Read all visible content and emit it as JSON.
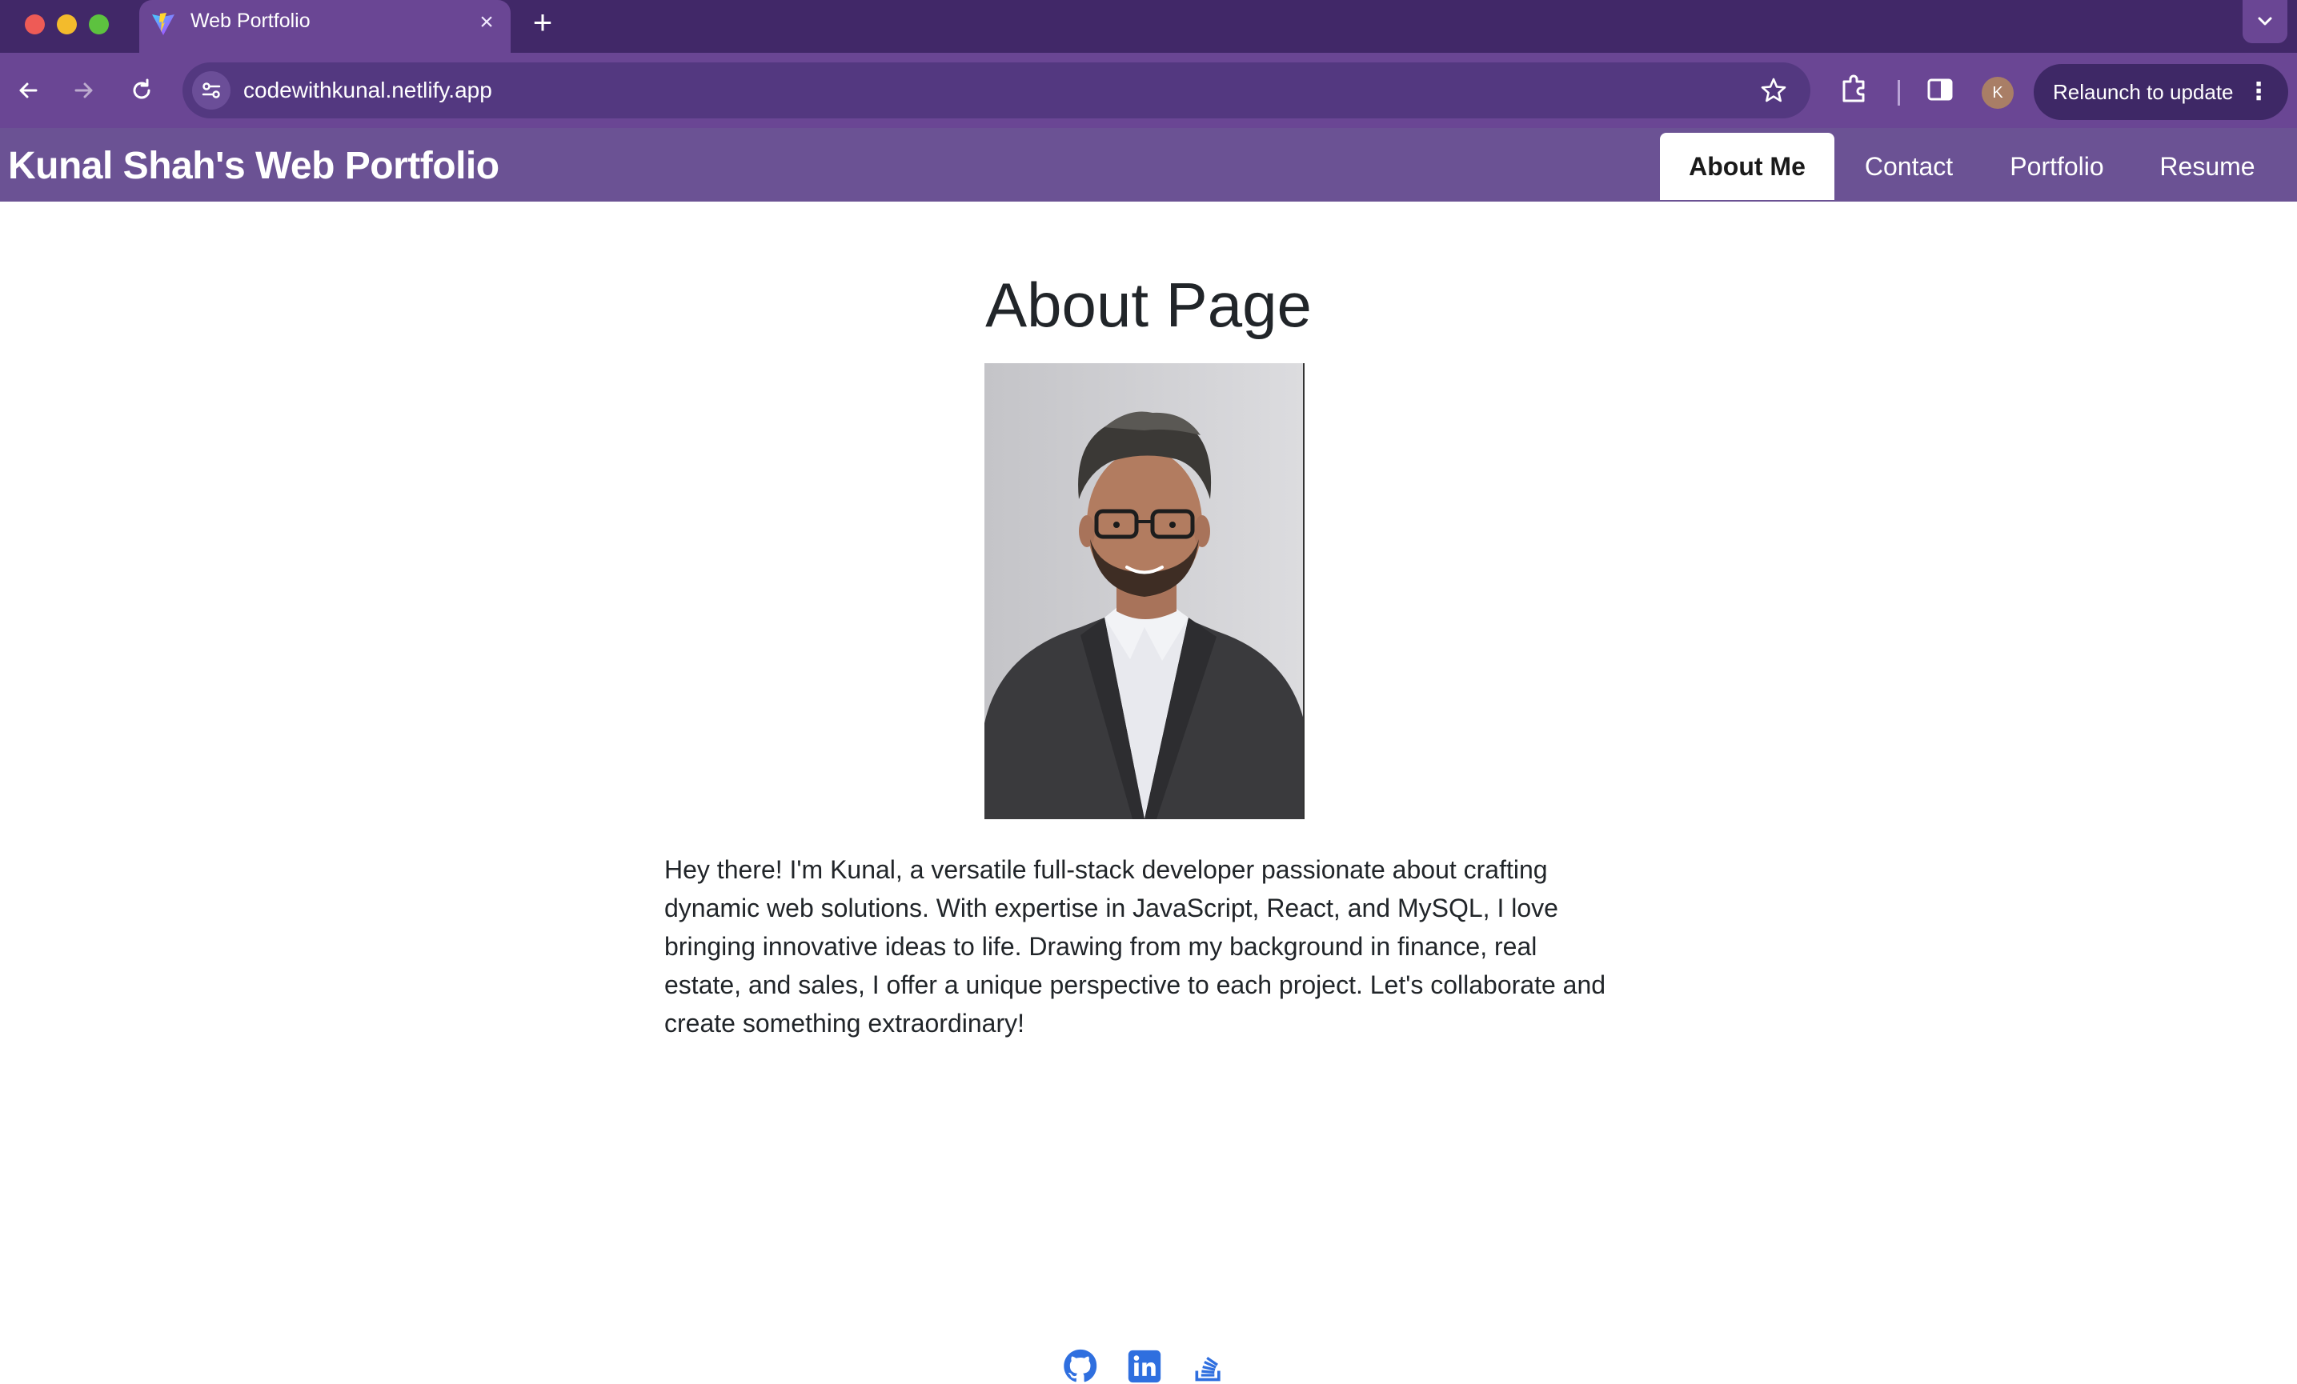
{
  "browser": {
    "tab_title": "Web Portfolio",
    "tab_close": "×",
    "new_tab": "+",
    "url": "codewithkunal.netlify.app",
    "profile_initial": "K",
    "relaunch_label": "Relaunch to update",
    "menu_glyph": "⋮"
  },
  "header": {
    "title": "Kunal Shah's Web Portfolio",
    "nav": [
      {
        "label": "About Me",
        "active": true
      },
      {
        "label": "Contact"
      },
      {
        "label": "Portfolio"
      },
      {
        "label": "Resume"
      }
    ]
  },
  "main": {
    "heading": "About Page",
    "bio": "Hey there! I'm Kunal, a versatile full-stack developer passionate about crafting dynamic web solutions. With expertise in JavaScript, React, and MySQL, I love bringing innovative ideas to life. Drawing from my background in finance, real estate, and sales, I offer a unique perspective to each project. Let's collaborate and create something extraordinary!"
  },
  "footer": {
    "icons": [
      "github-icon",
      "linkedin-icon",
      "stackoverflow-icon"
    ]
  },
  "colors": {
    "tabstrip": "#412868",
    "toolbar": "#6a4694",
    "header": "#6b5294",
    "social_blue": "#2f6fdf"
  }
}
